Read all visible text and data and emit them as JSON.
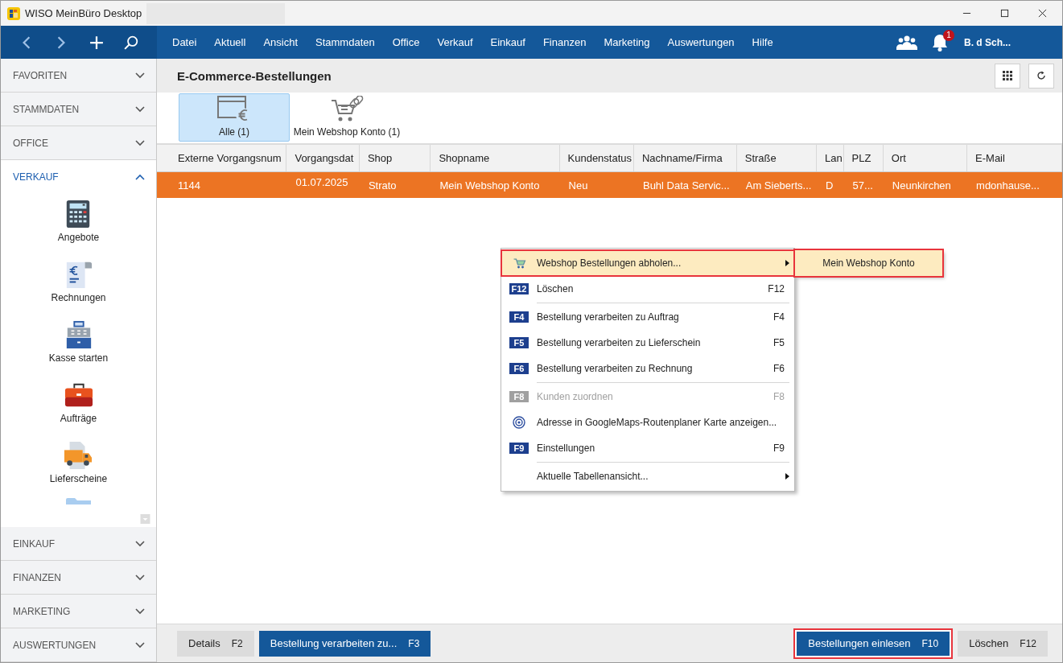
{
  "window": {
    "title": "WISO MeinBüro Desktop"
  },
  "menu_bar": {
    "items": [
      "Datei",
      "Aktuell",
      "Ansicht",
      "Stammdaten",
      "Office",
      "Verkauf",
      "Einkauf",
      "Finanzen",
      "Marketing",
      "Auswertungen",
      "Hilfe"
    ],
    "notification_count": "1",
    "user": "B. d Sch..."
  },
  "sidebar": {
    "sections_top": [
      {
        "label": "FAVORITEN",
        "expanded": false
      },
      {
        "label": "STAMMDATEN",
        "expanded": false
      },
      {
        "label": "OFFICE",
        "expanded": false
      },
      {
        "label": "VERKAUF",
        "expanded": true
      }
    ],
    "items": [
      {
        "label": "Angebote",
        "kind": "calculator"
      },
      {
        "label": "Rechnungen",
        "kind": "invoice"
      },
      {
        "label": "Kasse starten",
        "kind": "register"
      },
      {
        "label": "Aufträge",
        "kind": "briefcase"
      },
      {
        "label": "Lieferscheine",
        "kind": "truck"
      }
    ],
    "sections_bottom": [
      {
        "label": "EINKAUF",
        "expanded": false
      },
      {
        "label": "FINANZEN",
        "expanded": false
      },
      {
        "label": "MARKETING",
        "expanded": false
      },
      {
        "label": "AUSWERTUNGEN",
        "expanded": false
      }
    ]
  },
  "page": {
    "title": "E-Commerce-Bestellungen"
  },
  "filters": [
    {
      "label": "Alle (1)",
      "kind": "all",
      "selected": true
    },
    {
      "label": "Mein Webshop Konto (1)",
      "kind": "shop",
      "selected": false
    }
  ],
  "table": {
    "columns": [
      "Externe Vorgangsnum",
      "Vorgangsdat",
      "Shop",
      "Shopname",
      "Kundenstatus",
      "Nachname/Firma",
      "Straße",
      "Lan",
      "PLZ",
      "Ort",
      "E-Mail"
    ],
    "rows": [
      {
        "selected": true,
        "cells": [
          "1144",
          "01.07.2025",
          "Strato",
          "Mein Webshop Konto",
          "Neu",
          "Buhl Data Servic...",
          "Am Sieberts...",
          "D",
          "57...",
          "Neunkirchen",
          "mdonhause..."
        ]
      }
    ]
  },
  "context_menu": {
    "items": [
      {
        "kind": "cart",
        "label": "Webshop Bestellungen abholen...",
        "has_submenu": true,
        "highlighted": true,
        "disabled": false,
        "separator_before": false
      },
      {
        "kind": "key",
        "key": "F12",
        "label": "Löschen",
        "shortcut": "F12",
        "has_submenu": false,
        "highlighted": false,
        "disabled": false,
        "separator_before": false
      },
      {
        "kind": "key",
        "key": "F4",
        "label": "Bestellung verarbeiten zu Auftrag",
        "shortcut": "F4",
        "has_submenu": false,
        "highlighted": false,
        "disabled": false,
        "separator_before": true
      },
      {
        "kind": "key",
        "key": "F5",
        "label": "Bestellung verarbeiten zu Lieferschein",
        "shortcut": "F5",
        "has_submenu": false,
        "highlighted": false,
        "disabled": false,
        "separator_before": false
      },
      {
        "kind": "key",
        "key": "F6",
        "label": "Bestellung verarbeiten zu Rechnung",
        "shortcut": "F6",
        "has_submenu": false,
        "highlighted": false,
        "disabled": false,
        "separator_before": false
      },
      {
        "kind": "key",
        "key": "F8",
        "label": "Kunden zuordnen",
        "shortcut": "F8",
        "has_submenu": false,
        "highlighted": false,
        "disabled": true,
        "separator_before": true
      },
      {
        "kind": "target",
        "label": "Adresse in GoogleMaps-Routenplaner Karte anzeigen...",
        "has_submenu": false,
        "highlighted": false,
        "disabled": false,
        "separator_before": false
      },
      {
        "kind": "key",
        "key": "F9",
        "label": "Einstellungen",
        "shortcut": "F9",
        "has_submenu": false,
        "highlighted": false,
        "disabled": false,
        "separator_before": false
      },
      {
        "kind": "plain",
        "label": "Aktuelle Tabellenansicht...",
        "has_submenu": true,
        "highlighted": false,
        "disabled": false,
        "separator_before": true
      }
    ],
    "submenu": {
      "label": "Mein Webshop Konto",
      "highlighted": true
    }
  },
  "footer_buttons": [
    {
      "label": "Details",
      "key": "F2",
      "kind": "secondary",
      "highlighted": false
    },
    {
      "label": "Bestellung verarbeiten zu...",
      "key": "F3",
      "kind": "primary",
      "highlighted": false
    },
    {
      "kind": "spacer"
    },
    {
      "label": "Bestellungen einlesen",
      "key": "F10",
      "kind": "primary",
      "highlighted": true
    },
    {
      "label": "Löschen",
      "key": "F12",
      "kind": "secondary",
      "highlighted": false
    }
  ]
}
